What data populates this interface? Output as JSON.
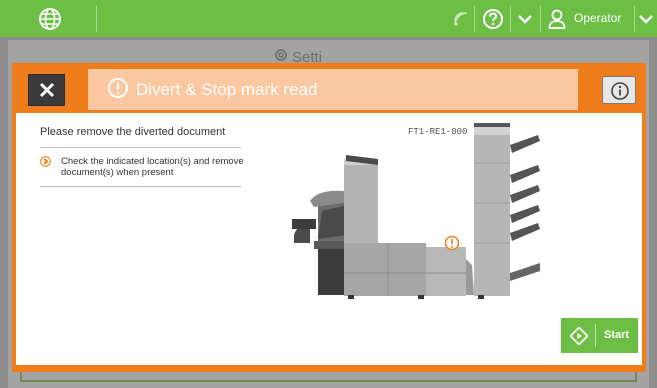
{
  "topbar": {
    "user_label": "Operator",
    "icons": [
      "globe-icon",
      "network-icon",
      "help-icon",
      "chevron-down-icon",
      "user-icon",
      "chevron-down-icon"
    ]
  },
  "background_page": {
    "title": "Setti"
  },
  "modal": {
    "title": "Divert & Stop mark read",
    "heading": "Please remove the diverted document",
    "instruction": "Check the indicated location(s) and remove document(s) when present",
    "machine_code": "FT1-RE1-000",
    "start_label": "Start"
  },
  "colors": {
    "accent_green": "#6cbf44",
    "warning_orange": "#f07d1b",
    "title_band": "#fac7a0"
  }
}
